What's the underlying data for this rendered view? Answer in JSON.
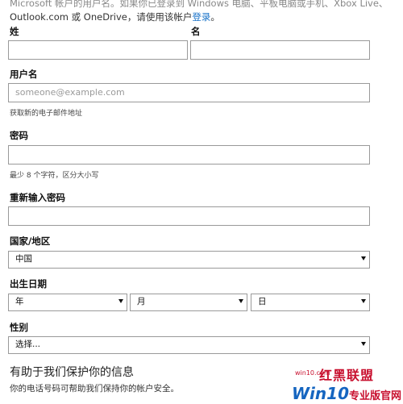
{
  "intro": {
    "line1": "Microsoft 帐户的用户名。如果你已登录到 Windows 电脑、平板电脑或手机、Xbox Live、",
    "line2_prefix": "Outlook.com 或 OneDrive，请使用该帐户",
    "login_link": "登录",
    "line2_suffix": "。"
  },
  "form": {
    "surname_label": "姓",
    "given_name_label": "名",
    "surname_value": "",
    "given_name_value": "",
    "username_label": "用户名",
    "username_placeholder": "someone@example.com",
    "get_email_link": "获取新的电子邮件地址",
    "password_label": "密码",
    "password_hint": "最少 8 个字符，区分大小写",
    "reenter_password_label": "重新输入密码",
    "country_label": "国家/地区",
    "country_value": "中国",
    "birthdate_label": "出生日期",
    "year_value": "年",
    "month_value": "月",
    "day_value": "日",
    "gender_label": "性别",
    "gender_value": "选择..."
  },
  "protect": {
    "title": "有助于我们保护你的信息",
    "description": "你的电话号码可帮助我们保持你的帐户安全。"
  },
  "watermark": {
    "top_text": "红黑联盟",
    "url_text": "win10.com",
    "brand_prefix": "Win10",
    "brand_suffix": "专业版官网"
  },
  "colors": {
    "link": "#1a73c8",
    "border": "#9a9a9a",
    "watermark_red": "#c8102e",
    "watermark_blue": "#1565c0"
  }
}
